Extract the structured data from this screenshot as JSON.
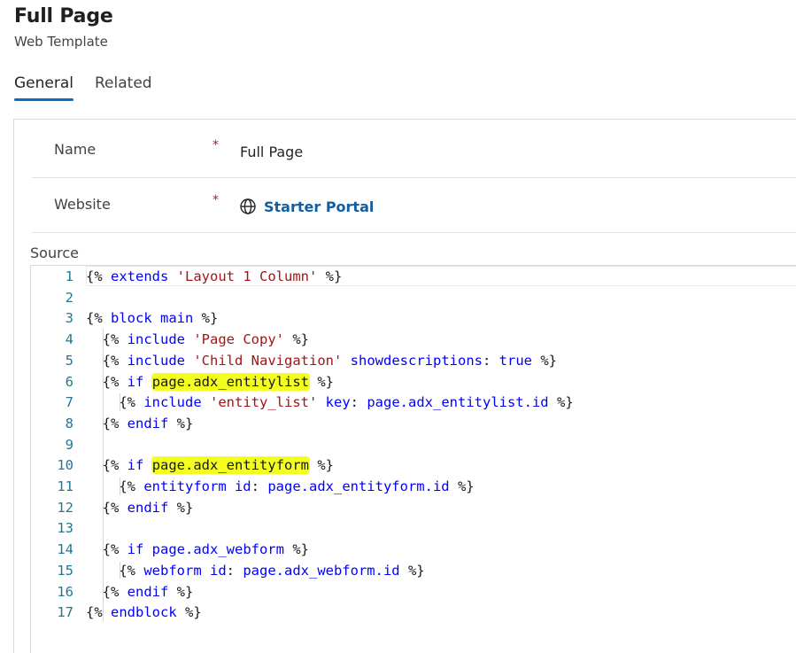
{
  "header": {
    "title": "Full Page",
    "subtitle": "Web Template"
  },
  "tabs": [
    {
      "label": "General",
      "active": true
    },
    {
      "label": "Related",
      "active": false
    }
  ],
  "fields": {
    "name": {
      "label": "Name",
      "required_mark": "*",
      "value": "Full Page"
    },
    "website": {
      "label": "Website",
      "required_mark": "*",
      "value": "Starter Portal",
      "icon": "globe-icon"
    }
  },
  "source": {
    "label": "Source",
    "line_numbers": [
      "1",
      "2",
      "3",
      "4",
      "5",
      "6",
      "7",
      "8",
      "9",
      "10",
      "11",
      "12",
      "13",
      "14",
      "15",
      "16",
      "17"
    ],
    "highlight_color": "#f5ff1f",
    "keyword_color": "#0000ff",
    "string_color": "#a31515",
    "lines": [
      [
        {
          "t": "{% "
        },
        {
          "t": "extends",
          "c": "kw"
        },
        {
          "t": " "
        },
        {
          "t": "'Layout 1 Column'",
          "c": "str"
        },
        {
          "t": " %}"
        }
      ],
      [],
      [
        {
          "t": "{% "
        },
        {
          "t": "block main",
          "c": "kw"
        },
        {
          "t": " %}"
        }
      ],
      [
        {
          "t": "  {% "
        },
        {
          "t": "include",
          "c": "kw"
        },
        {
          "t": " "
        },
        {
          "t": "'Page Copy'",
          "c": "str"
        },
        {
          "t": " %}"
        }
      ],
      [
        {
          "t": "  {% "
        },
        {
          "t": "include",
          "c": "kw"
        },
        {
          "t": " "
        },
        {
          "t": "'Child Navigation'",
          "c": "str"
        },
        {
          "t": " "
        },
        {
          "t": "showdescriptions",
          "c": "kw"
        },
        {
          "t": ": "
        },
        {
          "t": "true",
          "c": "kw"
        },
        {
          "t": " %}"
        }
      ],
      [
        {
          "t": "  {% "
        },
        {
          "t": "if",
          "c": "kw"
        },
        {
          "t": " "
        },
        {
          "t": "page.adx_entitylist",
          "c": "hl"
        },
        {
          "t": " %}"
        }
      ],
      [
        {
          "t": "    {% "
        },
        {
          "t": "include",
          "c": "kw"
        },
        {
          "t": " "
        },
        {
          "t": "'entity_list'",
          "c": "str"
        },
        {
          "t": " "
        },
        {
          "t": "key",
          "c": "kw"
        },
        {
          "t": ": "
        },
        {
          "t": "page.adx_entitylist.id",
          "c": "kw"
        },
        {
          "t": " %}"
        }
      ],
      [
        {
          "t": "  {% "
        },
        {
          "t": "endif",
          "c": "kw"
        },
        {
          "t": " %}"
        }
      ],
      [],
      [
        {
          "t": "  {% "
        },
        {
          "t": "if",
          "c": "kw"
        },
        {
          "t": " "
        },
        {
          "t": "page.adx_entityform",
          "c": "hl"
        },
        {
          "t": " %}"
        }
      ],
      [
        {
          "t": "    {% "
        },
        {
          "t": "entityform id",
          "c": "kw"
        },
        {
          "t": ": "
        },
        {
          "t": "page.adx_entityform.id",
          "c": "kw"
        },
        {
          "t": " %}"
        }
      ],
      [
        {
          "t": "  {% "
        },
        {
          "t": "endif",
          "c": "kw"
        },
        {
          "t": " %}"
        }
      ],
      [],
      [
        {
          "t": "  {% "
        },
        {
          "t": "if page.adx_webform",
          "c": "kw"
        },
        {
          "t": " %}"
        }
      ],
      [
        {
          "t": "    {% "
        },
        {
          "t": "webform id",
          "c": "kw"
        },
        {
          "t": ": "
        },
        {
          "t": "page.adx_webform.id",
          "c": "kw"
        },
        {
          "t": " %}"
        }
      ],
      [
        {
          "t": "  {% "
        },
        {
          "t": "endif",
          "c": "kw"
        },
        {
          "t": " %}"
        }
      ],
      [
        {
          "t": "{% "
        },
        {
          "t": "endblock",
          "c": "kw"
        },
        {
          "t": " %}"
        }
      ]
    ]
  }
}
